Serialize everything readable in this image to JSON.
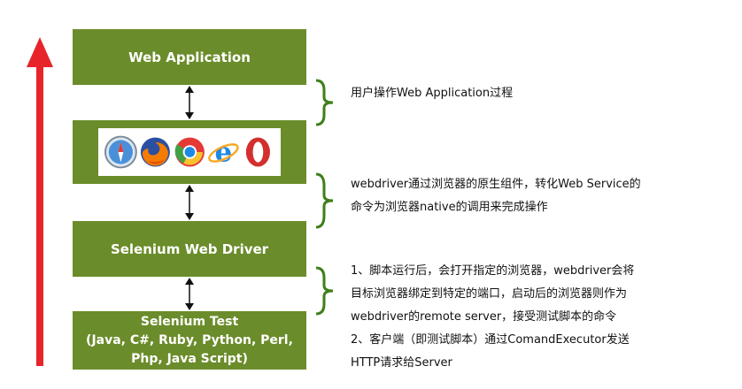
{
  "boxes": {
    "web_application": "Web Application",
    "selenium_web_driver": "Selenium Web Driver",
    "selenium_test": {
      "line1": "Selenium Test",
      "line2": "(Java, C#, Ruby, Python, Perl,",
      "line3": "Php, Java Script)"
    }
  },
  "browsers": [
    "safari-icon",
    "firefox-icon",
    "chrome-icon",
    "ie-icon",
    "opera-icon"
  ],
  "notes": {
    "note1": {
      "line1": "用户操作Web Application过程"
    },
    "note2": {
      "line1": "webdriver通过浏览器的原生组件，转化Web Service的",
      "line2": "命令为浏览器native的调用来完成操作"
    },
    "note3": {
      "line1": "1、脚本运行后，会打开指定的浏览器，webdriver会将",
      "line2": "目标浏览器绑定到特定的端口，启动后的浏览器则作为",
      "line3": "webdriver的remote server，接受测试脚本的命令",
      "line4": "2、客户端（即测试脚本）通过ComandExecutor发送",
      "line5": "HTTP请求给Server"
    }
  },
  "colors": {
    "box_green": "#6b8c2a",
    "brace_green": "#3f7f1a",
    "arrow_red": "#e8242b"
  }
}
